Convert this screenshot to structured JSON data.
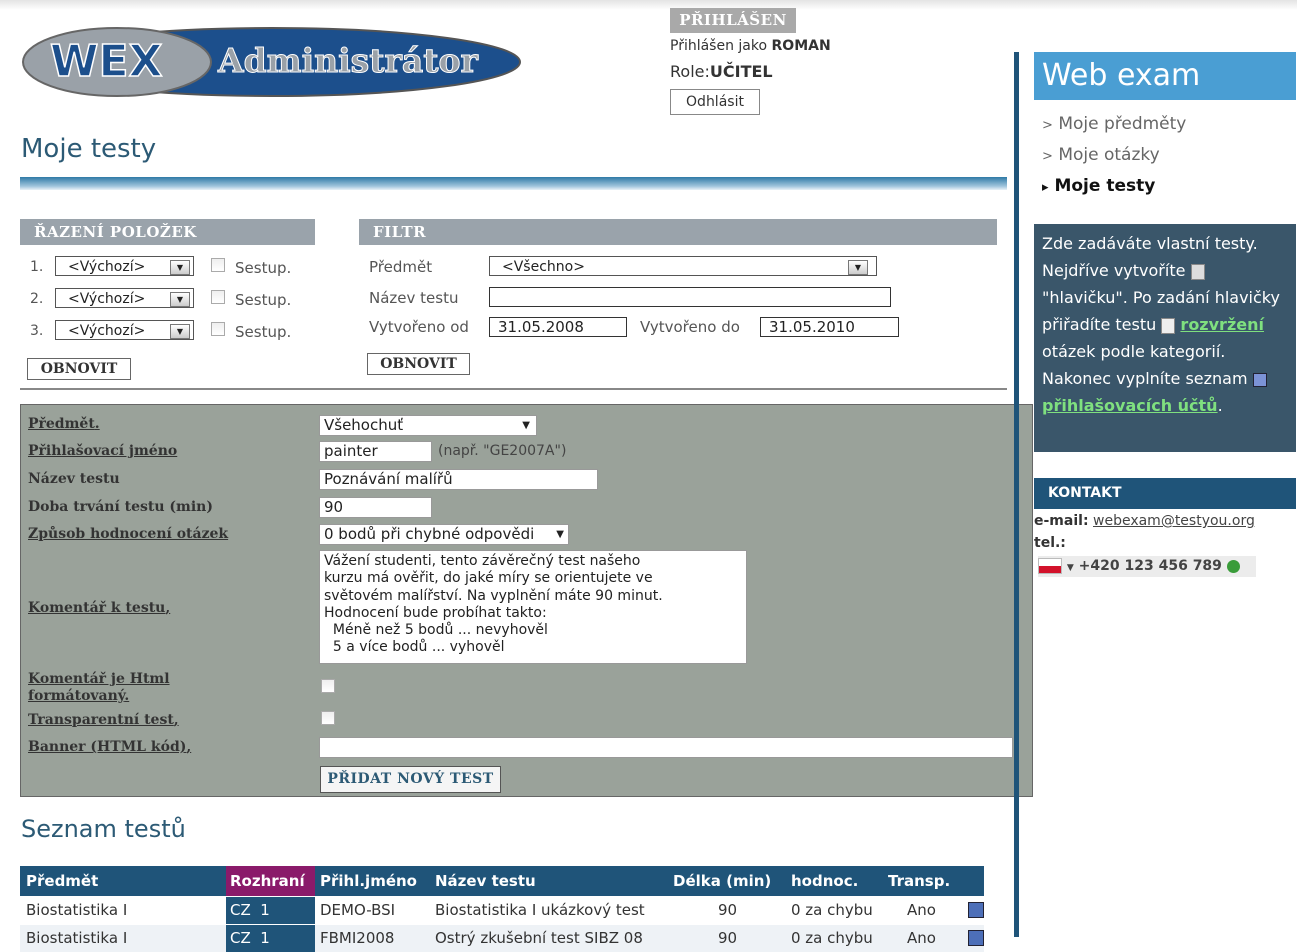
{
  "logo": {
    "left_text": "WEX",
    "right_text": "Administrátor"
  },
  "login": {
    "header": "PŘIHLÁŠEN",
    "prefix": "Přihlášen jako ",
    "user": "ROMAN",
    "role_label": "Role:",
    "role": "UČITEL",
    "logout": "Odhlásit"
  },
  "page_title": "Moje testy",
  "sorting": {
    "title": "ŘAZENÍ POLOŽEK",
    "rows": [
      {
        "num": "1.",
        "value": "<Výchozí>",
        "check": "Sestup."
      },
      {
        "num": "2.",
        "value": "<Výchozí>",
        "check": "Sestup."
      },
      {
        "num": "3.",
        "value": "<Výchozí>",
        "check": "Sestup."
      }
    ],
    "button": "OBNOVIT"
  },
  "filter": {
    "title": "FILTR",
    "subject_label": "Předmět",
    "subject_value": "<Všechno>",
    "name_label": "Název testu",
    "name_value": "",
    "created_from_label": "Vytvořeno od",
    "created_from": "31.05.2008",
    "created_to_label": "Vytvořeno do",
    "created_to": "31.05.2010",
    "button": "OBNOVIT"
  },
  "form": {
    "subject_label": "Předmět",
    "subject_value": "Všehochuť",
    "login_label": "Přihlašovací jméno",
    "login_value": "painter",
    "login_hint": "(např. \"GE2007A\")",
    "testname_label": "Název testu",
    "testname_value": "Poznávání malířů",
    "duration_label": "Doba trvání testu (min)",
    "duration_value": "90",
    "grading_label": "Způsob hodnocení otázek",
    "grading_value": "0 bodů při chybné odpovědi",
    "comment_label": "Komentář k testu",
    "comment_value": "Vážení studenti, tento závěrečný test našeho\nkurzu má ověřit, do jaké míry se orientujete ve\nsvětovém malířství. Na vyplnění máte 90 minut.\nHodnocení bude probíhat takto:\n  Méně než 5 bodů ... nevyhověl\n  5 a více bodů ... vyhověl",
    "html_label_1": "Komentář je Html",
    "html_label_2": "formátovaný",
    "transparent_label": "Transparentní test",
    "banner_label": "Banner (HTML kód)",
    "banner_value": "",
    "add_button": "PŘIDAT NOVÝ TEST"
  },
  "list": {
    "title": "Seznam testů",
    "headers": [
      "Předmět",
      "Rozhraní",
      "Přihl.jméno",
      "Název testu",
      "Délka (min)",
      "hodnoc.",
      "Transp."
    ],
    "rows": [
      [
        "Biostatistika I",
        "CZ",
        "1",
        "DEMO-BSI",
        "Biostatistika I ukázkový test",
        "90",
        "0 za chybu",
        "Ano"
      ],
      [
        "Biostatistika I",
        "CZ",
        "1",
        "FBMI2008",
        "Ostrý zkušební test SIBZ 08",
        "90",
        "0 za chybu",
        "Ano"
      ]
    ]
  },
  "sidebar": {
    "title": "Web exam",
    "nav": [
      {
        "marker": ">",
        "label": "Moje předměty"
      },
      {
        "marker": ">",
        "label": "Moje otázky"
      },
      {
        "marker": "▸",
        "label": "Moje testy"
      }
    ],
    "info_1": "Zde zadáváte vlastní testy. Nejdříve vytvoříte",
    "info_2": "\"hlavičku\". Po zadání hlavičky přiřadíte testu",
    "info_link1": "rozvržení",
    "info_3": " otázek podle kategorií. Nakonec vyplníte seznam",
    "info_link2": "přihlašovacích účtů",
    "info_4": ".",
    "contact_title": "KONTAKT",
    "email_label": "e-mail:",
    "email": "webexam@testyou.org",
    "tel_label": "tel.:",
    "tel": "+420 123 456 789"
  },
  "colors": {
    "accent": "#1f5479",
    "sidebar_head": "#4a9ed3",
    "form_bg": "#9aa29a",
    "info_bg": "#3a566a",
    "magenta": "#8a1a6a"
  },
  "icons": [
    "calendar-icon",
    "document-icon",
    "edit-icon",
    "phone-icon",
    "flag-cz-icon"
  ]
}
